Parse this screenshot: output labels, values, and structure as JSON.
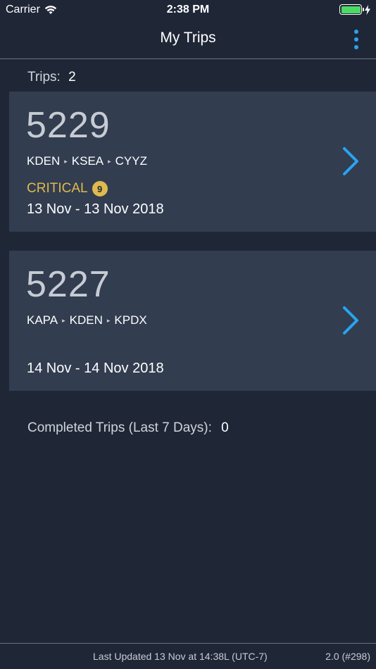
{
  "status_bar": {
    "carrier": "Carrier",
    "time": "2:38 PM",
    "battery_level": 1.0
  },
  "nav": {
    "title": "My Trips",
    "more_icon": "more-vertical-icon"
  },
  "trips_summary": {
    "label": "Trips:",
    "count": "2"
  },
  "trips": [
    {
      "number": "5229",
      "route": [
        "KDEN",
        "KSEA",
        "CYYZ"
      ],
      "critical_label": "CRITICAL",
      "critical_count": "9",
      "dates": "13 Nov - 13 Nov 2018"
    },
    {
      "number": "5227",
      "route": [
        "KAPA",
        "KDEN",
        "KPDX"
      ],
      "dates": "14 Nov - 14 Nov 2018"
    }
  ],
  "completed": {
    "label": "Completed Trips (Last 7 Days):",
    "count": "0"
  },
  "footer": {
    "last_updated": "Last Updated 13 Nov at 14:38L (UTC-7)",
    "version": "2.0 (#298)"
  },
  "colors": {
    "background": "#1f2737",
    "card": "#323d50",
    "accent": "#2aa3f0",
    "critical": "#e0b94f"
  }
}
